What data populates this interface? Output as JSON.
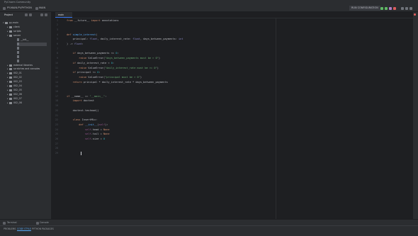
{
  "window": {
    "title": "PyCharm Community"
  },
  "toolbar": {
    "project": "PY-MAIN.PY/PYTHON",
    "branch": "MAIN",
    "config": "RUN CONFIGURATION"
  },
  "project_panel": {
    "title": "Project",
    "root": "py-main",
    "tree": [
      "client",
      "scripts",
      "server",
      "__init__",
      "",
      "",
      "",
      "",
      "",
      "",
      "",
      "external libraries",
      "scratches and consoles"
    ],
    "folders": [
      "002_01",
      "002_02",
      "002_03",
      "002_04",
      "002_05",
      "002_06",
      "002_07",
      "002_08"
    ]
  },
  "editor": {
    "tab_label": "main",
    "code": [
      [
        [
          "kw",
          "from"
        ],
        [
          "id",
          " __future__ "
        ],
        [
          "kw",
          "import"
        ],
        [
          "id",
          " annotations"
        ]
      ],
      [],
      [],
      [
        [
          "kw",
          "def"
        ],
        [
          "fn",
          " simple_interest"
        ],
        [
          "pr",
          "("
        ]
      ],
      [
        [
          "id",
          "    principal: "
        ],
        [
          "bi",
          "float"
        ],
        [
          "id",
          ", daily_interest_rate: "
        ],
        [
          "bi",
          "float"
        ],
        [
          "id",
          ", days_between_payments: "
        ],
        [
          "bi",
          "int"
        ]
      ],
      [
        [
          "pr",
          ") -> "
        ],
        [
          "bi",
          "float"
        ],
        [
          "pr",
          ":"
        ]
      ],
      [],
      [
        [
          "kw",
          "    if"
        ],
        [
          "id",
          " days_between_payments <= "
        ],
        [
          "nm",
          "0"
        ],
        [
          "pr",
          ":"
        ]
      ],
      [
        [
          "kw",
          "        raise"
        ],
        [
          "id",
          " ValueError("
        ],
        [
          "st",
          "\"days_between_payments must be > 0\""
        ],
        [
          "id",
          ")"
        ]
      ],
      [
        [
          "kw",
          "    if"
        ],
        [
          "id",
          " daily_interest_rate < "
        ],
        [
          "nm",
          "0"
        ],
        [
          "pr",
          ":"
        ]
      ],
      [
        [
          "kw",
          "        raise"
        ],
        [
          "id",
          " ValueError("
        ],
        [
          "st",
          "\"daily_interest_rate must be >= 0\""
        ],
        [
          "id",
          ")"
        ]
      ],
      [
        [
          "kw",
          "    if"
        ],
        [
          "id",
          " principal <= "
        ],
        [
          "nm",
          "0"
        ],
        [
          "pr",
          ":"
        ]
      ],
      [
        [
          "kw",
          "        raise"
        ],
        [
          "id",
          " ValueError("
        ],
        [
          "st",
          "\"principal must be > 0\""
        ],
        [
          "id",
          ")"
        ]
      ],
      [
        [
          "kw",
          "    return"
        ],
        [
          "id",
          " principal * daily_interest_rate * days_between_payments"
        ]
      ],
      [],
      [],
      [
        [
          "kw",
          "if"
        ],
        [
          "id",
          " __name__ == "
        ],
        [
          "st",
          "\"__main__\""
        ],
        [
          "pr",
          ":"
        ]
      ],
      [
        [
          "kw",
          "    import"
        ],
        [
          "id",
          " doctest"
        ]
      ],
      [],
      [
        [
          "id",
          "    doctest.testmod()"
        ]
      ],
      [],
      [
        [
          "kw",
          "    class"
        ],
        [
          "id",
          " InsertMix:"
        ]
      ],
      [
        [
          "kw",
          "        def"
        ],
        [
          "fn",
          " __init__"
        ],
        [
          "pr",
          "("
        ],
        [
          "sf",
          "self"
        ],
        [
          "pr",
          "):"
        ]
      ],
      [
        [
          "sf",
          "            self"
        ],
        [
          "id",
          ".head = "
        ],
        [
          "kw",
          "None"
        ]
      ],
      [
        [
          "sf",
          "            self"
        ],
        [
          "id",
          ".tail = "
        ],
        [
          "kw",
          "None"
        ]
      ],
      [
        [
          "sf",
          "            self"
        ],
        [
          "id",
          ".size = "
        ],
        [
          "nm",
          "0"
        ]
      ],
      [],
      [],
      [
        [
          "id",
          "    "
        ]
      ]
    ]
  },
  "bottom_tools": {
    "terminal": "Terminal",
    "console": "Console"
  },
  "statusbar": {
    "left": "PROBLEMS",
    "middle": "CODE STYLE",
    "right": "PYTHON PACKAGES"
  }
}
